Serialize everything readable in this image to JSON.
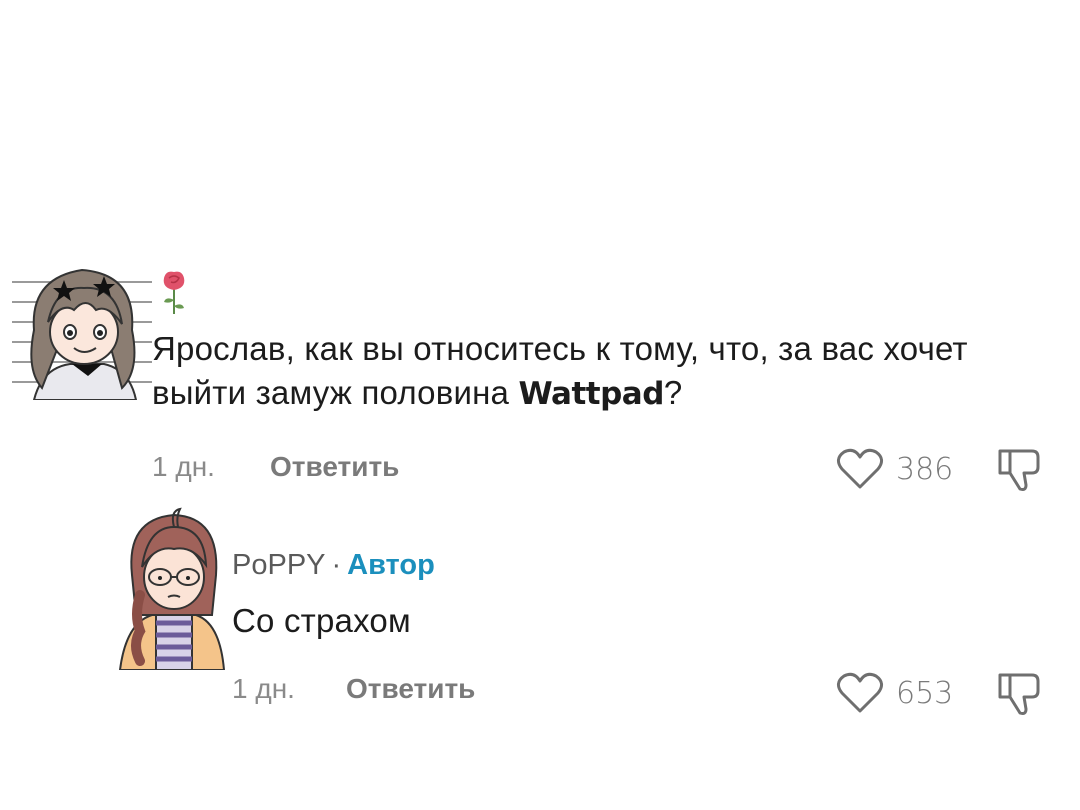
{
  "comments": [
    {
      "avatar_icon": "avatar-girl-brown-hair-icon",
      "flair_icon": "rose-icon",
      "text_before": "Ярослав, как вы относитесь к тому, что, за вас хочет выйти замуж половина ",
      "brand": "Wattpad",
      "text_after": "?",
      "time": "1 дн.",
      "reply_label": "Ответить",
      "likes": "386"
    },
    {
      "avatar_icon": "avatar-girl-glasses-braid-icon",
      "author": "PoPPY",
      "separator": "·",
      "badge": "Автор",
      "text": "Со страхом",
      "time": "1 дн.",
      "reply_label": "Ответить",
      "likes": "653"
    }
  ],
  "colors": {
    "author_badge": "#1b8fbd",
    "meta_text": "#8a8a8a",
    "icon_stroke": "#6f6f6f"
  }
}
